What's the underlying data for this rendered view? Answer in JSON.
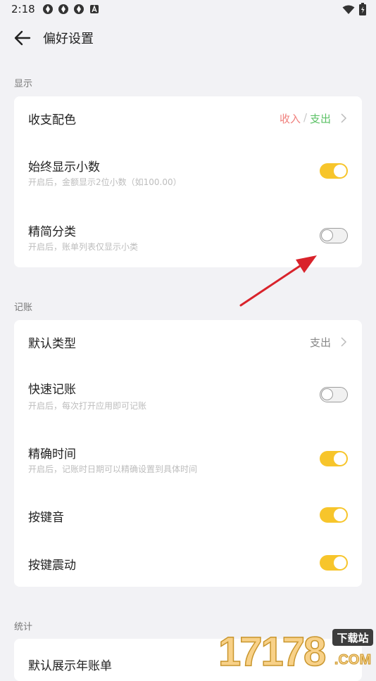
{
  "status_bar": {
    "time": "2:18"
  },
  "header": {
    "title": "偏好设置"
  },
  "sections": [
    {
      "label": "显示"
    },
    {
      "label": "记账"
    },
    {
      "label": "统计"
    }
  ],
  "display": {
    "color_scheme": {
      "title": "收支配色",
      "income": "收入",
      "separator": "/",
      "expense": "支出"
    },
    "decimals": {
      "title": "始终显示小数",
      "subtitle": "开启后，金额显示2位小数（如100.00）",
      "enabled": true
    },
    "simple_category": {
      "title": "精简分类",
      "subtitle": "开启后，账单列表仅显示小类",
      "enabled": false
    }
  },
  "bookkeeping": {
    "default_type": {
      "title": "默认类型",
      "value": "支出"
    },
    "quick_entry": {
      "title": "快速记账",
      "subtitle": "开启后，每次打开应用即可记账",
      "enabled": false
    },
    "precise_time": {
      "title": "精确时间",
      "subtitle": "开启后，记账时日期可以精确设置到具体时间",
      "enabled": true
    },
    "key_sound": {
      "title": "按键音",
      "enabled": true
    },
    "key_vibration": {
      "title": "按键震动",
      "enabled": true
    }
  },
  "stats": {
    "default_yearly": {
      "title": "默认展示年账单"
    }
  },
  "watermark": {
    "text": "17178",
    "badge": "下载站",
    "domain": ".COM"
  },
  "colors": {
    "accent": "#F7C52B",
    "income": "#F0807D",
    "expense": "#5DC267",
    "annotation_arrow": "#D9232B"
  }
}
